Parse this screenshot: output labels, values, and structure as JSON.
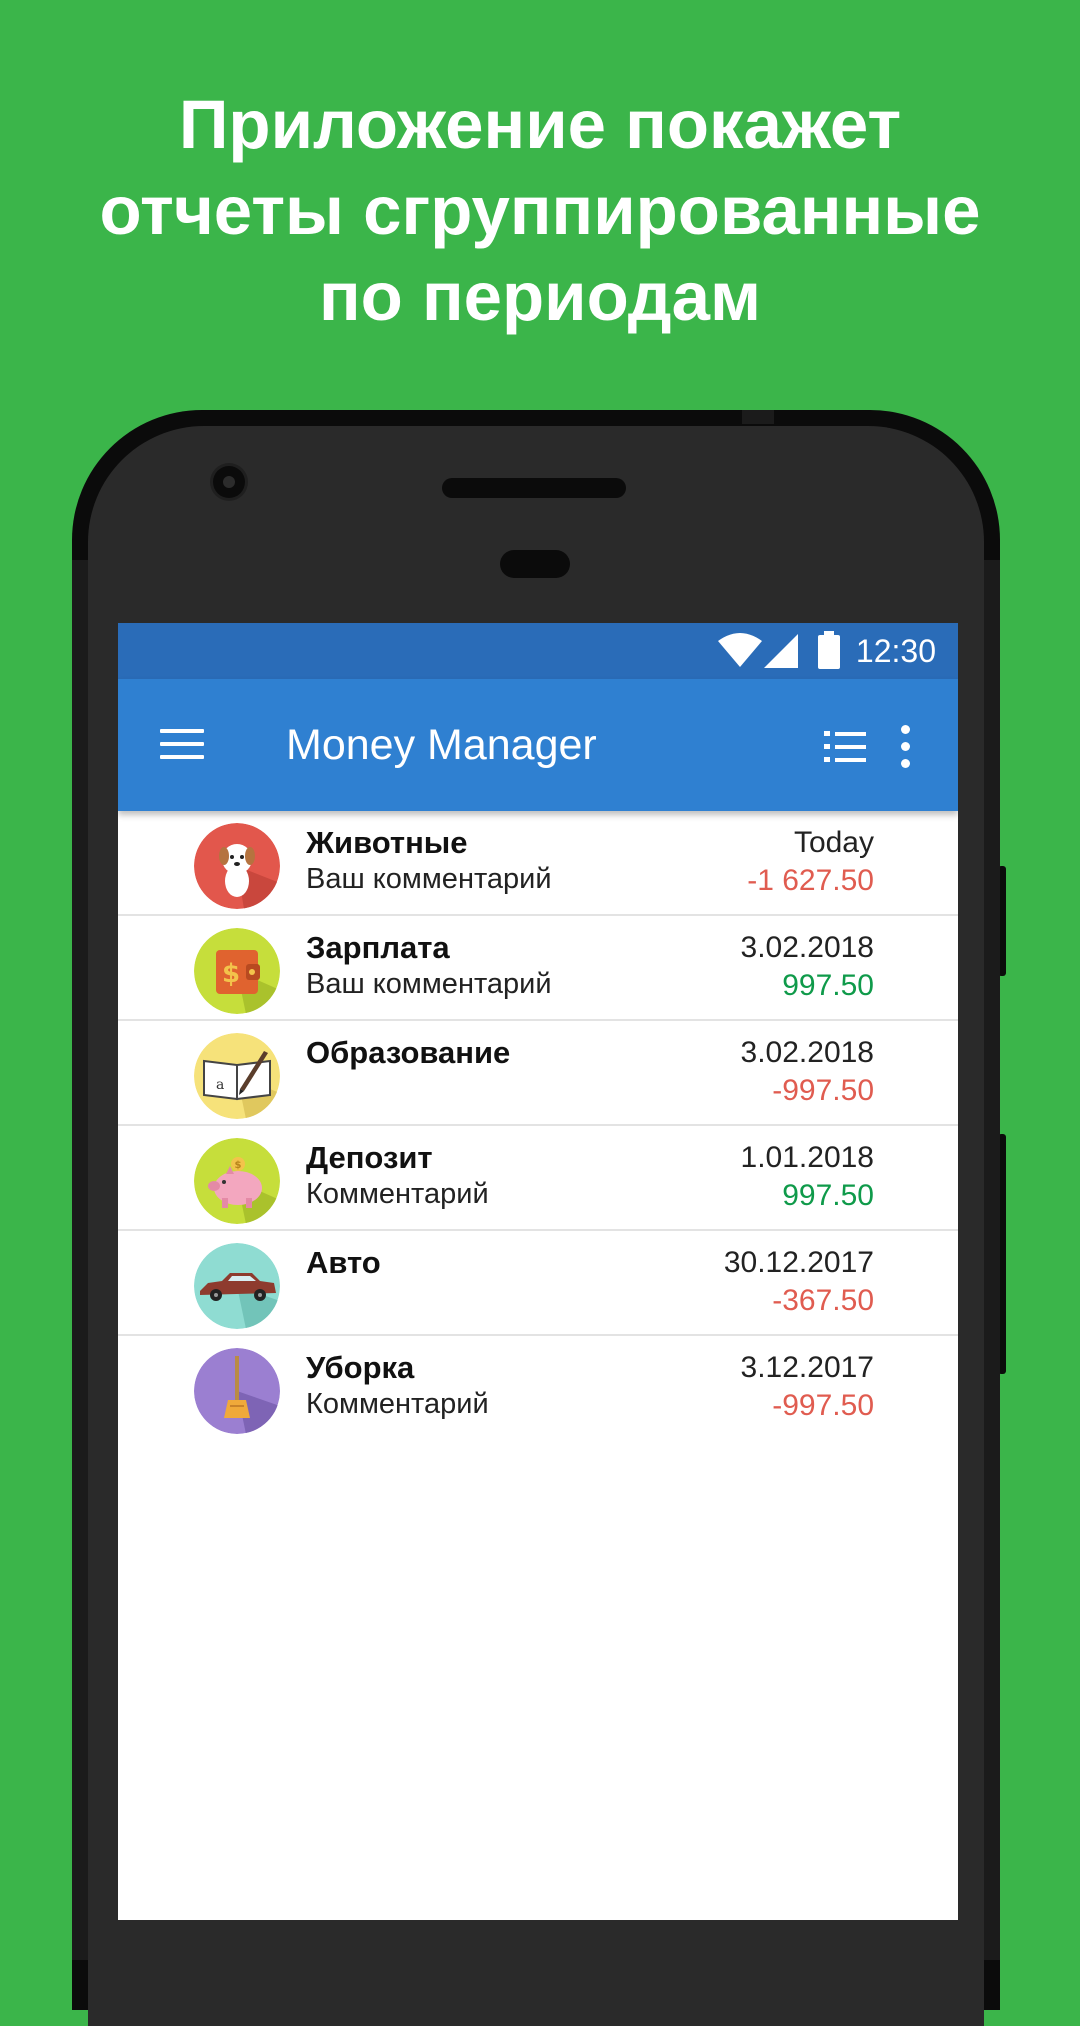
{
  "headline": {
    "line1": "Приложение покажет",
    "line2": "отчеты сгруппированные",
    "line3": "по периодам"
  },
  "status_bar": {
    "time": "12:30"
  },
  "app_bar": {
    "title": "Money Manager"
  },
  "colors": {
    "background": "#3bb54a",
    "status_bar": "#2a6cb8",
    "app_bar": "#2f80d1",
    "expense": "#e05c50",
    "income": "#0f9a4a"
  },
  "transactions": [
    {
      "category": "Животные",
      "comment": "Ваш комментарий",
      "date": "Today",
      "amount": "-1 627.50",
      "type": "expense",
      "icon": "dog-icon",
      "icon_color": "#e2574c"
    },
    {
      "category": "Зарплата",
      "comment": "Ваш комментарий",
      "date": "3.02.2018",
      "amount": "997.50",
      "type": "income",
      "icon": "wallet-icon",
      "icon_color": "#c6de3b"
    },
    {
      "category": "Образование",
      "comment": "",
      "date": "3.02.2018",
      "amount": "-997.50",
      "type": "expense",
      "icon": "book-pen-icon",
      "icon_color": "#f6e27a"
    },
    {
      "category": "Депозит",
      "comment": "Комментарий",
      "date": "1.01.2018",
      "amount": "997.50",
      "type": "income",
      "icon": "piggy-bank-icon",
      "icon_color": "#c6de3b"
    },
    {
      "category": "Авто",
      "comment": "",
      "date": "30.12.2017",
      "amount": "-367.50",
      "type": "expense",
      "icon": "car-icon",
      "icon_color": "#8fdcd2"
    },
    {
      "category": "Уборка",
      "comment": "Комментарий",
      "date": "3.12.2017",
      "amount": "-997.50",
      "type": "expense",
      "icon": "broom-icon",
      "icon_color": "#9b7fd1"
    }
  ]
}
